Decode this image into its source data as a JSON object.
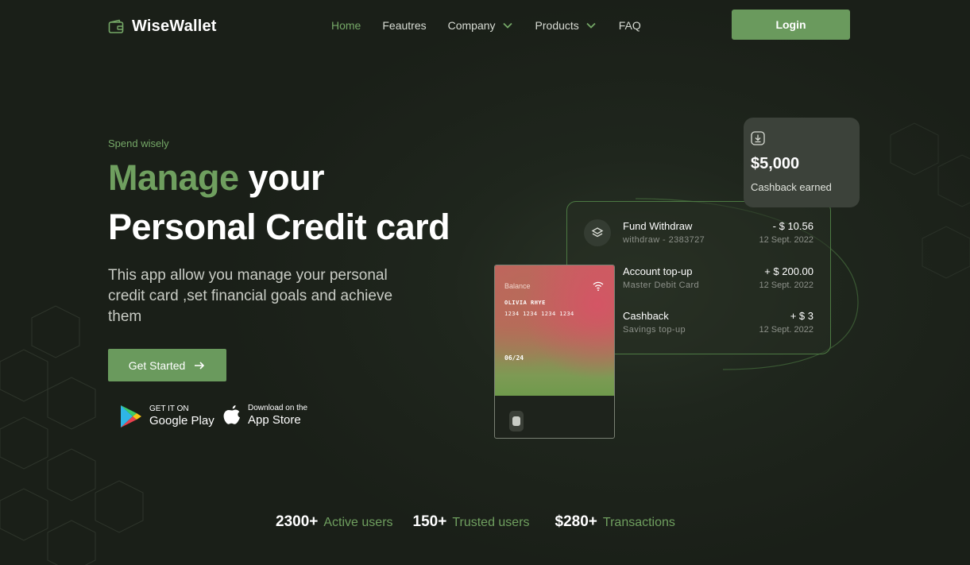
{
  "brand": {
    "name": "WiseWallet",
    "icon": "wallet-icon"
  },
  "nav": {
    "items": [
      {
        "label": "Home",
        "active": true,
        "dropdown": false
      },
      {
        "label": "Feautres",
        "active": false,
        "dropdown": false
      },
      {
        "label": "Company",
        "active": false,
        "dropdown": true
      },
      {
        "label": "Products",
        "active": false,
        "dropdown": true
      },
      {
        "label": "FAQ",
        "active": false,
        "dropdown": false
      }
    ],
    "login_label": "Login"
  },
  "hero": {
    "eyebrow": "Spend wisely",
    "title_accent": "Manage",
    "title_rest": " your",
    "title_line2": "Personal Credit card",
    "description": "This app allow you manage your personal credit card ,set financial goals and achieve them",
    "cta_label": "Get Started"
  },
  "stores": {
    "google_play": {
      "small": "GET IT ON",
      "big": "Google Play"
    },
    "app_store": {
      "small": "Download on the",
      "big": "App Store"
    }
  },
  "stats": [
    {
      "value": "2300+",
      "label": "Active users"
    },
    {
      "value": "150+",
      "label": "Trusted users"
    },
    {
      "value": "$280+",
      "label": "Transactions"
    }
  ],
  "cashback": {
    "value": "$5,000",
    "label": "Cashback earned",
    "icon": "download-icon"
  },
  "transactions": [
    {
      "title": "Fund Withdraw",
      "sub": "withdraw - 2383727",
      "amount": "- $ 10.56",
      "date": "12 Sept. 2022"
    },
    {
      "title": "Account top-up",
      "sub": "Master Debit Card",
      "amount": "+ $ 200.00",
      "date": "12 Sept. 2022"
    },
    {
      "title": "Cashback",
      "sub": "Savings top-up",
      "amount": "+ $ 3",
      "date": "12 Sept. 2022"
    }
  ],
  "card": {
    "balance_label": "Balance",
    "holder": "OLIVIA RHYE",
    "number": "1234 1234 1234 1234",
    "expiry": "06/24"
  },
  "colors": {
    "accent": "#6a9a5d",
    "background": "#1f261d",
    "accent_text": "#75a867"
  }
}
